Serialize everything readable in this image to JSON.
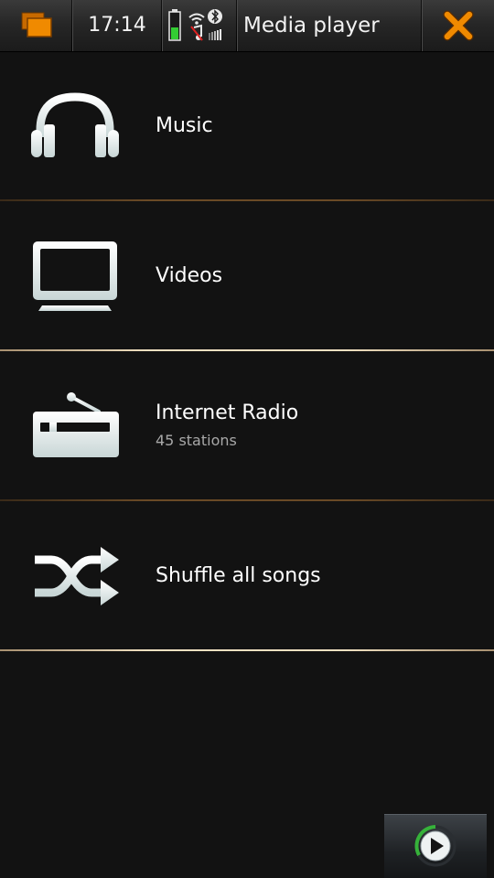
{
  "status_bar": {
    "time": "17:14",
    "title": "Media player"
  },
  "menu": {
    "items": [
      {
        "label": "Music",
        "subtitle": ""
      },
      {
        "label": "Videos",
        "subtitle": ""
      },
      {
        "label": "Internet Radio",
        "subtitle": "45 stations"
      },
      {
        "label": "Shuffle all songs",
        "subtitle": ""
      }
    ]
  },
  "colors": {
    "background": "#121212",
    "accent": "#f08a00",
    "icon_fill": "#e8eeee",
    "progress_ring": "#36b23a",
    "battery_level": "#33cc33"
  },
  "icons": {
    "task_switcher": "task-switcher-icon",
    "battery": "battery-icon",
    "wifi": "wifi-icon",
    "bluetooth": "bluetooth-icon",
    "close": "close-icon",
    "music": "headphones-icon",
    "videos": "tv-icon",
    "radio": "radio-icon",
    "shuffle": "shuffle-icon",
    "now_playing": "play-icon"
  },
  "battery": {
    "level": 0.45
  }
}
